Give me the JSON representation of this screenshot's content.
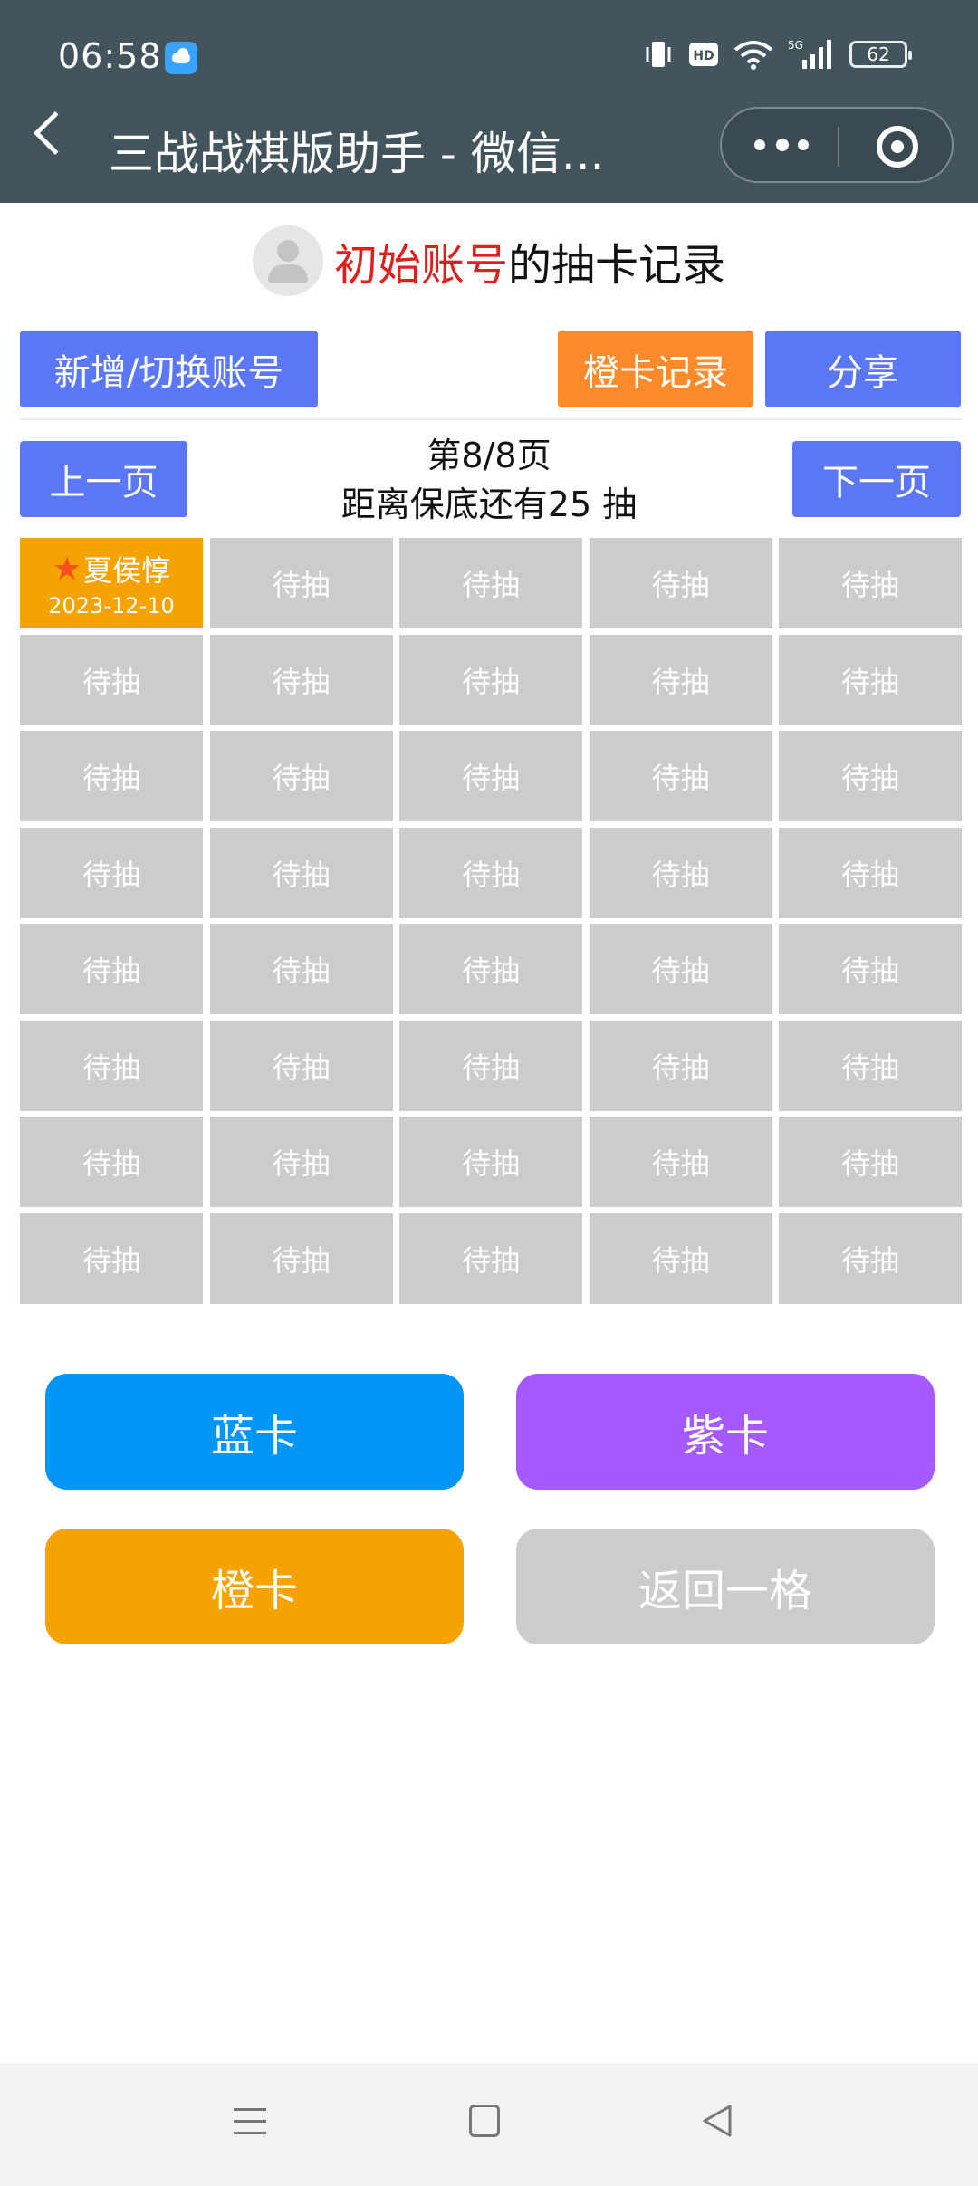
{
  "status_bar": {
    "time": "06:58",
    "network_label": "5G",
    "hd_label": "HD",
    "battery": "62"
  },
  "nav": {
    "title": "三战战棋版助手 - 微信..."
  },
  "header": {
    "account_name": "初始账号",
    "title_suffix": "的抽卡记录"
  },
  "toolbar": {
    "switch_account": "新增/切换账号",
    "orange_records": "橙卡记录",
    "share": "分享"
  },
  "pager": {
    "prev": "上一页",
    "next": "下一页",
    "page_label": "第8/8页",
    "pity_label": "距离保底还有25 抽"
  },
  "grid": {
    "first_card_name": "夏侯惇",
    "first_card_date": "2023-12-10",
    "pending_label": "待抽",
    "pending_count": 39
  },
  "actions": {
    "blue": "蓝卡",
    "purple": "紫卡",
    "orange": "橙卡",
    "undo": "返回一格"
  },
  "colors": {
    "header_bg": "#42555c",
    "primary_blue": "#5b77f5",
    "orange": "#fb8a2b",
    "card_orange": "#f6a200",
    "action_blue": "#0096f5",
    "action_purple": "#a55afd",
    "action_orange": "#f6a200",
    "pending_gray": "#cccccc",
    "account_red": "#e0201f"
  }
}
